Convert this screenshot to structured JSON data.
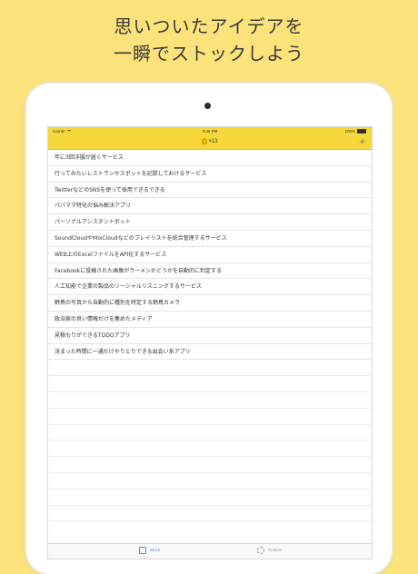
{
  "headline": {
    "line1": "思いついたアイデアを",
    "line2": "一瞬でストックしよう"
  },
  "status": {
    "carrier": "Carrier",
    "time": "3:46 PM",
    "battery": "100%"
  },
  "nav": {
    "title": "×13",
    "icon": "bulb-icon",
    "add_label": "+"
  },
  "ideas": [
    "年に3回洋服が届くサービス",
    "行ってみたいレストランやスポットを記録しておけるサービス",
    "TwitterなどのSNSを使って採用できるできる",
    "パパママ特化の悩み解決アプリ",
    "パーソナルアシスタントボット",
    "SoundCloudやMixCloudなどのプレイリストを統合管理するサービス",
    "WEB上のExcelファイルをAPI化するサービス",
    "Facebookに投稿された画像がラーメンかどうかを自動的に判定する",
    "人工知能で企業の製品のソーシャルリスニングするサービス",
    "野鳥の写真から自動的に種別を特定する野鳥カメラ",
    "政治家の良い情報だけを集めたメディア",
    "見積もりができるTODOアプリ",
    "決まった時間に一通だけやりとりできる出会い系アプリ"
  ],
  "tabs": {
    "stock": "Stock",
    "custom": "Custom"
  },
  "colors": {
    "background": "#fce27a",
    "nav_bar": "#f7d83a"
  }
}
